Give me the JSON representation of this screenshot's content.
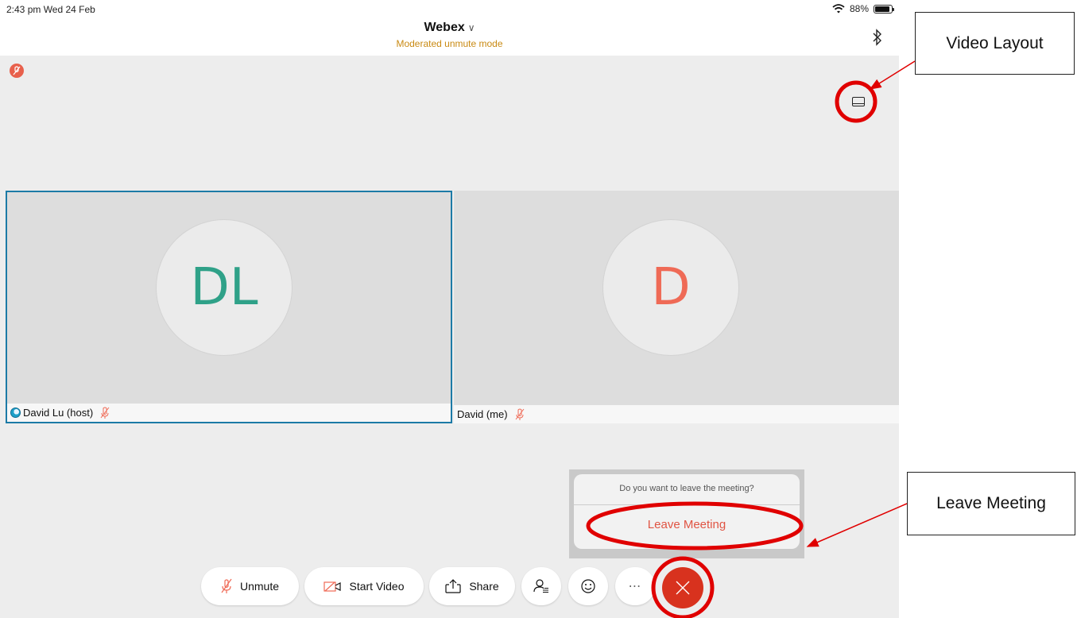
{
  "status": {
    "time": "2:43 pm  Wed 24 Feb",
    "battery": "88%",
    "battery_level": 0.88
  },
  "header": {
    "title": "Webex",
    "subtitle": "Moderated unmute mode"
  },
  "participants": [
    {
      "name": "David Lu (host)",
      "initials": "DL",
      "initials_color": "#2fa188"
    },
    {
      "name": "David (me)",
      "initials": "D",
      "initials_color": "#ef6a56"
    }
  ],
  "leave_dialog": {
    "question": "Do you want to leave the meeting?",
    "action": "Leave Meeting"
  },
  "toolbar": {
    "unmute": "Unmute",
    "start_video": "Start Video",
    "share": "Share",
    "more": "⋯"
  },
  "annotations": {
    "video_layout": "Video Layout",
    "leave_meeting": "Leave Meeting"
  },
  "colors": {
    "accent_red": "#d8321e",
    "mute_red": "#e8604c",
    "mode_orange": "#c98a13",
    "active_border": "#1c7aa6",
    "annotation_red": "#e00000"
  }
}
